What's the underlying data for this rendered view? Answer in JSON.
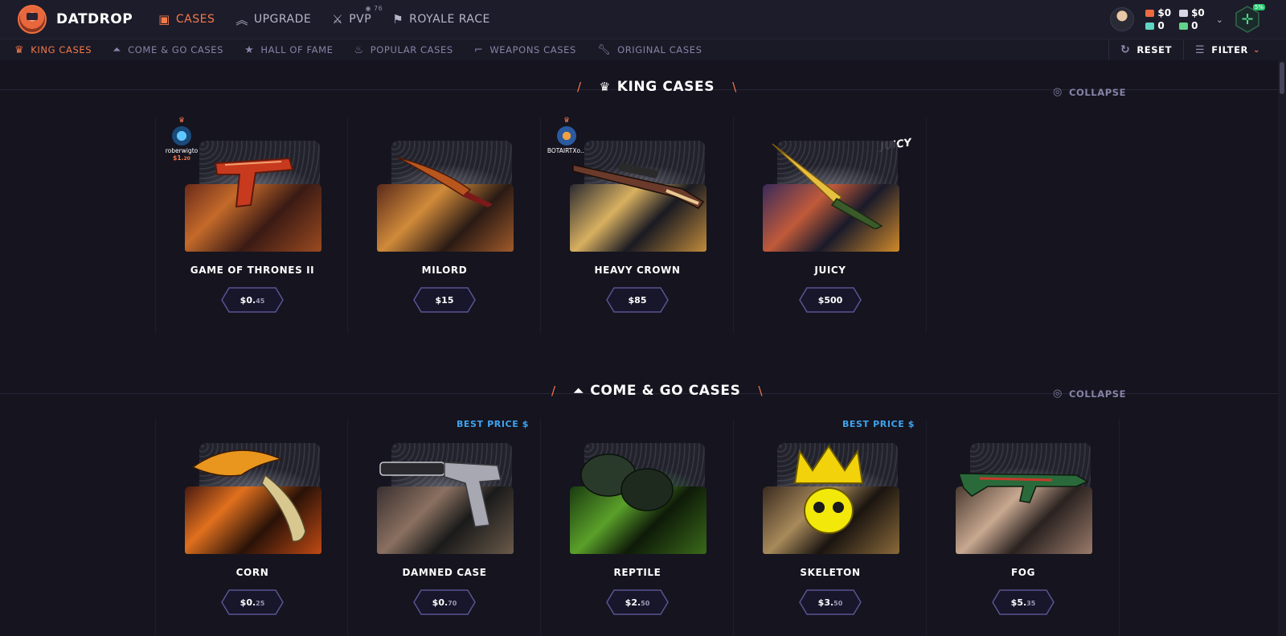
{
  "header": {
    "logo_text": "DATDROP",
    "nav": [
      {
        "label": "CASES",
        "icon": "briefcase-icon",
        "active": true
      },
      {
        "label": "UPGRADE",
        "icon": "upgrade-chevron-icon",
        "active": false
      },
      {
        "label": "PVP",
        "icon": "crossed-swords-icon",
        "active": false,
        "viewer_count": "76"
      },
      {
        "label": "ROYALE RACE",
        "icon": "flag-icon",
        "active": false
      }
    ],
    "balances": {
      "cash": "$0",
      "weapons": "$0",
      "coins": "0",
      "diamonds": "0"
    },
    "deposit_badge": "5%"
  },
  "subnav": {
    "items": [
      {
        "label": "KING CASES",
        "icon": "crown-icon",
        "active": true
      },
      {
        "label": "COME & GO CASES",
        "icon": "double-chevron-icon",
        "active": false
      },
      {
        "label": "HALL OF FAME",
        "icon": "star-icon",
        "active": false
      },
      {
        "label": "POPULAR CASES",
        "icon": "flame-icon",
        "active": false
      },
      {
        "label": "WEAPONS CASES",
        "icon": "rifle-icon",
        "active": false
      },
      {
        "label": "ORIGINAL CASES",
        "icon": "wrench-icon",
        "active": false
      }
    ],
    "reset_label": "RESET",
    "filter_label": "FILTER"
  },
  "sections": [
    {
      "title": "KING CASES",
      "icon": "crown-icon",
      "collapse_label": "COLLAPSE",
      "cards": [
        {
          "name": "GAME OF THRONES II",
          "price_main": "$0.",
          "price_cents": "45",
          "king_user": "roberwigto",
          "king_price_main": "$1.",
          "king_price_cents": "20"
        },
        {
          "name": "MILORD",
          "price_main": "$15",
          "price_cents": ""
        },
        {
          "name": "HEAVY CROWN",
          "price_main": "$85",
          "price_cents": "",
          "king_user": "BOTAIRTXo..."
        },
        {
          "name": "JUICY",
          "price_main": "$500",
          "price_cents": "",
          "case_label": "JUICY"
        }
      ]
    },
    {
      "title": "COME & GO CASES",
      "icon": "double-chevron-icon",
      "collapse_label": "COLLAPSE",
      "cards": [
        {
          "name": "CORN",
          "price_main": "$0.",
          "price_cents": "25"
        },
        {
          "name": "DAMNED CASE",
          "price_main": "$0.",
          "price_cents": "70",
          "best_label": "BEST PRICE $"
        },
        {
          "name": "REPTILE",
          "price_main": "$2.",
          "price_cents": "50"
        },
        {
          "name": "SKELETON",
          "price_main": "$3.",
          "price_cents": "50",
          "best_label": "BEST PRICE $"
        },
        {
          "name": "FOG",
          "price_main": "$5.",
          "price_cents": "35"
        }
      ]
    }
  ],
  "colors": {
    "accent": "#f37a4a",
    "background": "#15141f",
    "header": "#1d1c2a",
    "best_price": "#3ea4f0",
    "muted_text": "#8583a6"
  }
}
